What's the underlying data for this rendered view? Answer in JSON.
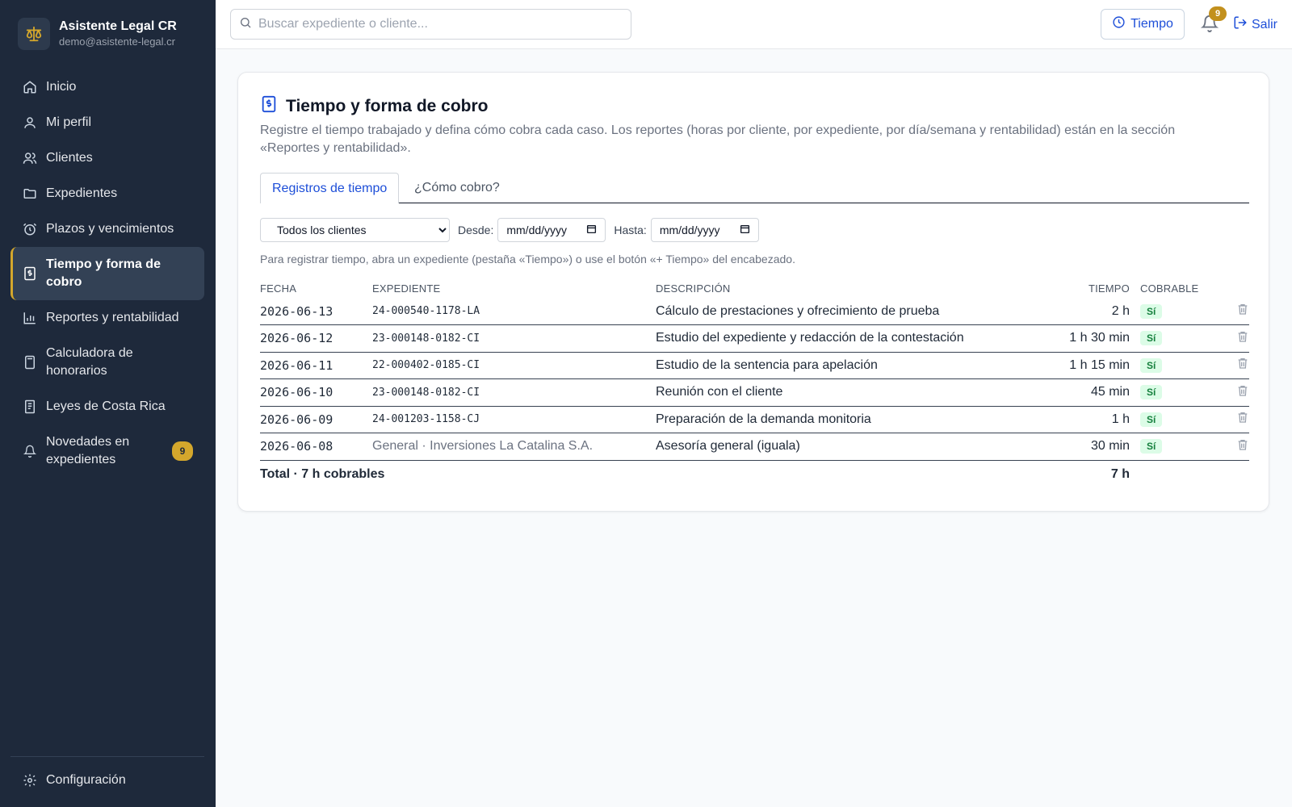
{
  "brand": {
    "name": "Asistente Legal CR",
    "email": "demo@asistente-legal.cr"
  },
  "nav": {
    "items": [
      {
        "label": "Inicio",
        "icon": "home-icon"
      },
      {
        "label": "Mi perfil",
        "icon": "user-icon"
      },
      {
        "label": "Clientes",
        "icon": "users-icon"
      },
      {
        "label": "Expedientes",
        "icon": "folder-icon"
      },
      {
        "label": "Plazos y vencimientos",
        "icon": "alarm-clock-icon"
      },
      {
        "label": "Tiempo y forma de cobro",
        "icon": "receipt-icon",
        "active": true
      },
      {
        "label": "Reportes y rentabilidad",
        "icon": "bar-chart-icon"
      },
      {
        "label": "Calculadora de honorarios",
        "icon": "calculator-icon"
      },
      {
        "label": "Leyes de Costa Rica",
        "icon": "book-icon"
      },
      {
        "label": "Novedades en expedientes",
        "icon": "bell-icon",
        "badge": "9"
      }
    ],
    "settings_label": "Configuración"
  },
  "topbar": {
    "search_placeholder": "Buscar expediente o cliente...",
    "time_button": "Tiempo",
    "notifications_count": "9",
    "logout_label": "Salir"
  },
  "page": {
    "title": "Tiempo y forma de cobro",
    "description": "Registre el tiempo trabajado y defina cómo cobra cada caso. Los reportes (horas por cliente, por expediente, por día/semana y rentabilidad) están en la sección «Reportes y rentabilidad».",
    "tabs": [
      {
        "label": "Registros de tiempo",
        "active": true
      },
      {
        "label": "¿Cómo cobro?",
        "active": false
      }
    ],
    "filters": {
      "client_selected": "Todos los clientes",
      "from_label": "Desde:",
      "to_label": "Hasta:",
      "date_placeholder": "mm/dd/yyyy"
    },
    "hint": "Para registrar tiempo, abra un expediente (pestaña «Tiempo») o use el botón «+ Tiempo» del encabezado.",
    "table": {
      "headers": [
        "FECHA",
        "EXPEDIENTE",
        "DESCRIPCIÓN",
        "TIEMPO",
        "COBRABLE"
      ],
      "rows": [
        {
          "date": "2026-06-13",
          "case": "24-000540-1178-LA",
          "description": "Cálculo de prestaciones y ofrecimiento de prueba",
          "time": "2 h",
          "billable": "Sí"
        },
        {
          "date": "2026-06-12",
          "case": "23-000148-0182-CI",
          "description": "Estudio del expediente y redacción de la contestación",
          "time": "1 h 30 min",
          "billable": "Sí"
        },
        {
          "date": "2026-06-11",
          "case": "22-000402-0185-CI",
          "description": "Estudio de la sentencia para apelación",
          "time": "1 h 15 min",
          "billable": "Sí"
        },
        {
          "date": "2026-06-10",
          "case": "23-000148-0182-CI",
          "description": "Reunión con el cliente",
          "time": "45 min",
          "billable": "Sí"
        },
        {
          "date": "2026-06-09",
          "case": "24-001203-1158-CJ",
          "description": "Preparación de la demanda monitoria",
          "time": "1 h",
          "billable": "Sí"
        },
        {
          "date": "2026-06-08",
          "case": "General · Inversiones La Catalina S.A.",
          "description": "Asesoría general (iguala)",
          "time": "30 min",
          "billable": "Sí",
          "general": true
        }
      ],
      "total_label": "Total · 7 h cobrables",
      "total_time": "7 h"
    }
  },
  "colors": {
    "sidebar": "#1e293b",
    "accent": "#1d4ed8",
    "gold": "#d4a72c",
    "billable_bg": "#dcfce7",
    "billable_text": "#15803d"
  }
}
